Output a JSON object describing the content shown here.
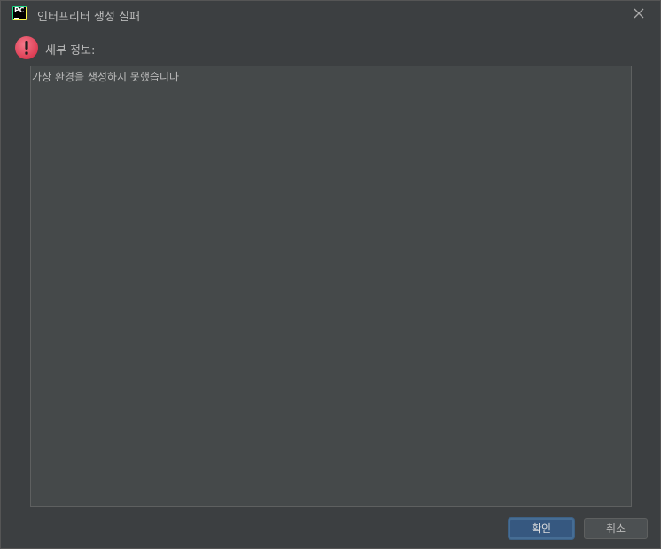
{
  "window": {
    "title": "인터프리터 생성 실패",
    "app_icon": "pycharm-logo",
    "app_icon_text": "PC"
  },
  "dialog": {
    "icon": "error-icon",
    "details_label": "세부 정보:",
    "details_text": "가상 환경을 생성하지 못했습니다"
  },
  "buttons": {
    "ok_label": "확인",
    "cancel_label": "취소"
  },
  "colors": {
    "background": "#3c3f41",
    "text_area": "#45494a",
    "primary_button": "#365880",
    "error": "#e0485a"
  }
}
